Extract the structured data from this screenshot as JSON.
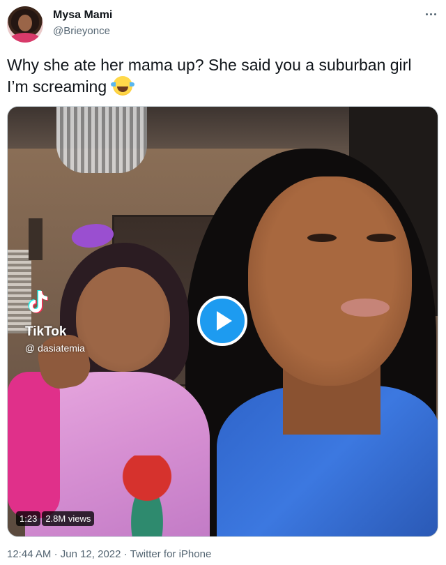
{
  "author": {
    "display_name": "Mysa Mami",
    "handle": "@Brieyonce"
  },
  "tweet": {
    "text": "Why she ate her mama up? She said you a suburban girl I’m screaming",
    "emoji": "face-with-tears-of-joy"
  },
  "media": {
    "watermark_brand": "TikTok",
    "watermark_user": "@ dasiatemia",
    "duration": "1:23",
    "views": "2.8M views"
  },
  "meta": {
    "time": "12:44 AM",
    "separator": "·",
    "date": "Jun 12, 2022",
    "source": "Twitter for iPhone"
  },
  "colors": {
    "accent": "#1d9bf0",
    "text_primary": "#0f1419",
    "text_secondary": "#536471"
  }
}
